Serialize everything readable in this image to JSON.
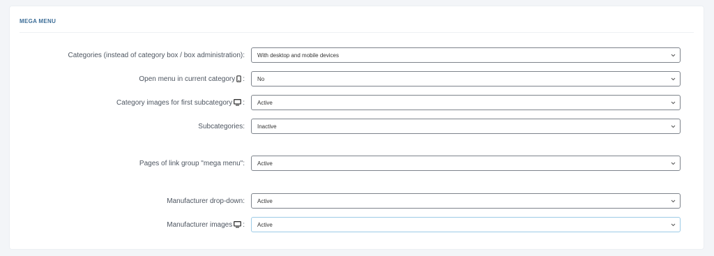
{
  "section": {
    "title": "MEGA MENU"
  },
  "rows": [
    {
      "label": "Categories (instead of category box / box administration):",
      "value": "With desktop and mobile devices",
      "icon": ""
    },
    {
      "label": "Open menu in current category",
      "value": "No",
      "icon": "mobile-icon"
    },
    {
      "label": "Category images for first subcategory",
      "value": "Active",
      "icon": "desktop-icon"
    },
    {
      "label": "Subcategories:",
      "value": "Inactive",
      "icon": ""
    },
    {
      "label": "Pages of link group \"mega menu\":",
      "value": "Active",
      "icon": ""
    },
    {
      "label": "Manufacturer drop-down:",
      "value": "Active",
      "icon": ""
    },
    {
      "label": "Manufacturer images",
      "value": "Active",
      "icon": "desktop-icon"
    }
  ],
  "colon": ":"
}
